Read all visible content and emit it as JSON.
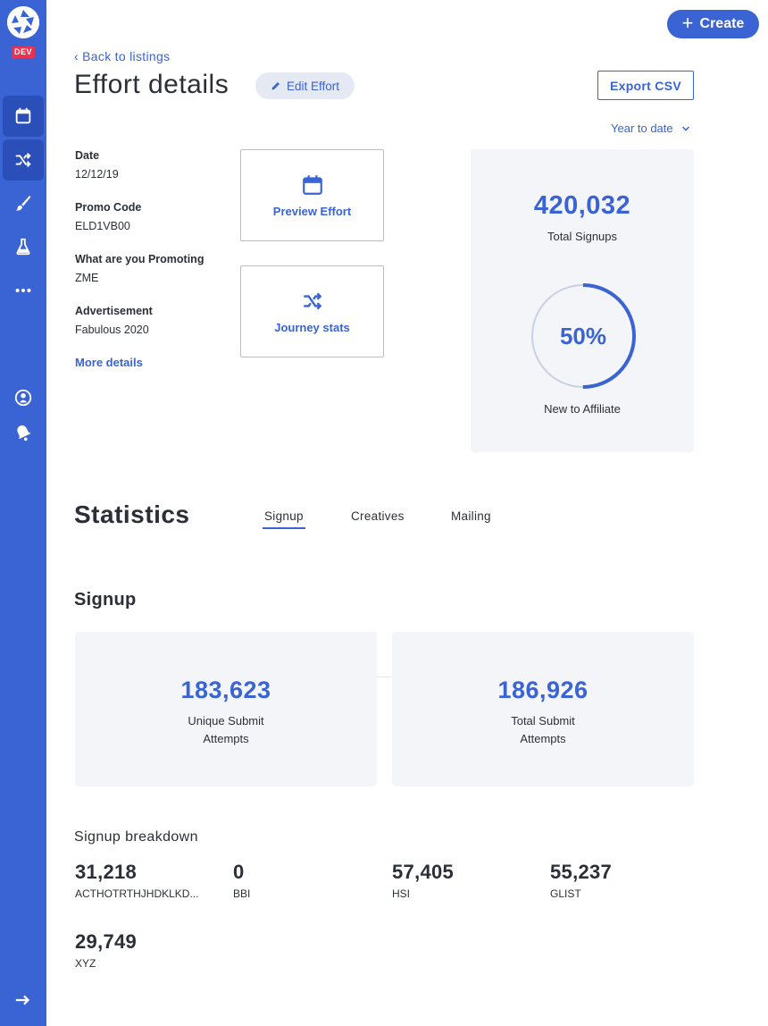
{
  "sidebar": {
    "env_badge": "DEV",
    "nav": [
      {
        "icon": "calendar-icon",
        "active": true
      },
      {
        "icon": "shuffle-icon",
        "active": true
      },
      {
        "icon": "brush-icon",
        "active": false
      },
      {
        "icon": "flask-icon",
        "active": false
      },
      {
        "icon": "more-icon",
        "active": false
      },
      {
        "icon": "user-icon",
        "active": false
      },
      {
        "icon": "bell-icon",
        "active": false
      },
      {
        "icon": "logout-arrow-icon",
        "active": false
      }
    ]
  },
  "header": {
    "create_label": "Create",
    "back_label": "Back to listings",
    "title": "Effort details",
    "edit_label": "Edit Effort",
    "export_label": "Export CSV",
    "range_label": "Year to date"
  },
  "details": {
    "date_label": "Date",
    "date_value": "12/12/19",
    "promo_label": "Promo Code",
    "promo_value": "ELD1VB00",
    "promoting_label": "What are you Promoting",
    "promoting_value": "ZME",
    "ad_label": "Advertisement",
    "ad_value": "Fabulous 2020",
    "more_label": "More details"
  },
  "actions": {
    "preview_label": "Preview Effort",
    "journey_label": "Journey stats"
  },
  "summary": {
    "total_signups": "420,032",
    "total_signups_label": "Total Signups",
    "new_pct_text": "50%",
    "new_pct_value": 0.5,
    "new_label": "New to Affiliate"
  },
  "statistics": {
    "title": "Statistics",
    "tabs": [
      "Signup",
      "Creatives",
      "Mailing"
    ],
    "active_tab": "Signup",
    "section_title": "Signup",
    "cards": [
      {
        "value": "183,623",
        "label_line1": "Unique Submit",
        "label_line2": "Attempts"
      },
      {
        "value": "186,926",
        "label_line1": "Total Submit",
        "label_line2": "Attempts"
      }
    ],
    "breakdown_title": "Signup breakdown",
    "breakdown": [
      {
        "value": "31,218",
        "label": "ACTHOTRTHJHDKLKD..."
      },
      {
        "value": "0",
        "label": "BBI"
      },
      {
        "value": "57,405",
        "label": "HSI"
      },
      {
        "value": "55,237",
        "label": "GLIST"
      },
      {
        "value": "29,749",
        "label": "XYZ"
      }
    ]
  },
  "colors": {
    "brand": "#3a63d3",
    "sidebar_active": "#2b4fb8",
    "badge": "#e8324f",
    "panel_bg": "#f4f5f9"
  }
}
